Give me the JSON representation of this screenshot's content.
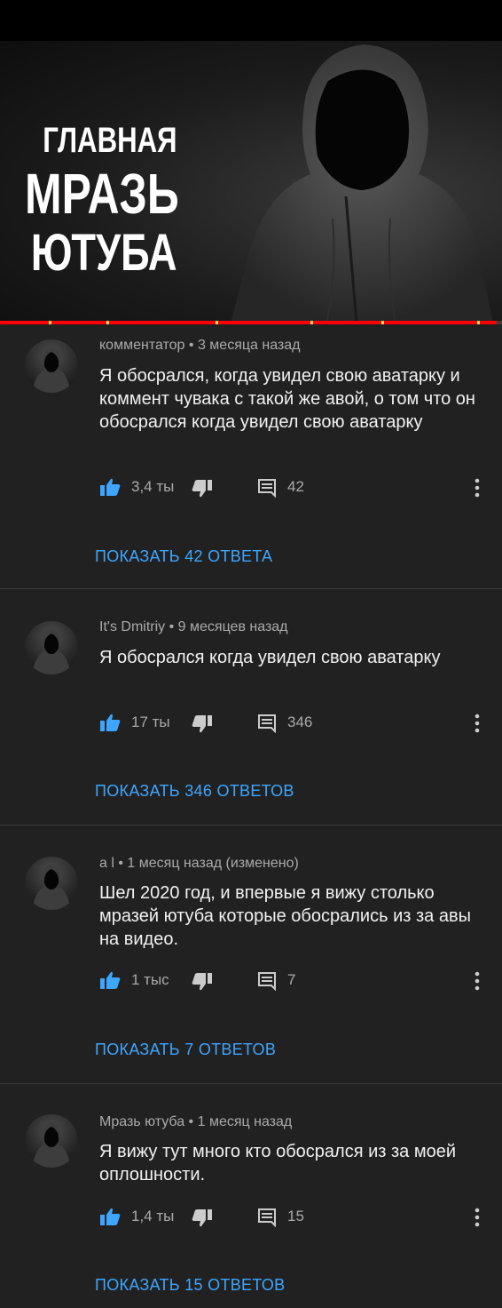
{
  "thumbnail": {
    "title_line1": "ГЛАВНАЯ",
    "title_line2": "МРАЗЬ",
    "title_line3": "ЮТУБА",
    "progress_fraction": 0.99
  },
  "colors": {
    "background": "#212121",
    "link": "#3ea6ff",
    "like_active": "#3ea6ff",
    "progress": "#ff0000"
  },
  "comments": [
    {
      "author": "комментатор",
      "time": "3 месяца назад",
      "text": "Я обосрался, когда увидел свою аватарку и коммент чувака с такой же авой, о том что он обосрался когда увидел свою аватарку",
      "likes": "3,4 ты",
      "replies": "42",
      "show_replies": "ПОКАЗАТЬ 42 ОТВЕТА"
    },
    {
      "author": "It's Dmitriy",
      "time": "9 месяцев назад",
      "text": "Я обосрался когда увидел свою аватарку",
      "likes": "17 ты",
      "replies": "346",
      "show_replies": "ПОКАЗАТЬ 346 ОТВЕТОВ"
    },
    {
      "author": "a l",
      "time": "1 месяц назад (изменено)",
      "text": "Шел 2020 год, и впервые я вижу столько мразей ютуба которые обосрались из за авы на видео.",
      "likes": "1 тыс",
      "replies": "7",
      "show_replies": "ПОКАЗАТЬ 7 ОТВЕТОВ"
    },
    {
      "author": "Мразь ютуба",
      "time": "1 месяц назад",
      "text": "Я вижу тут много кто обосрался из за моей оплошности.",
      "likes": "1,4 ты",
      "replies": "15",
      "show_replies": "ПОКАЗАТЬ 15 ОТВЕТОВ"
    }
  ],
  "icons": {
    "like": "thumbs-up-icon",
    "dislike": "thumbs-down-icon",
    "reply": "comment-icon",
    "more": "kebab-menu-icon"
  }
}
